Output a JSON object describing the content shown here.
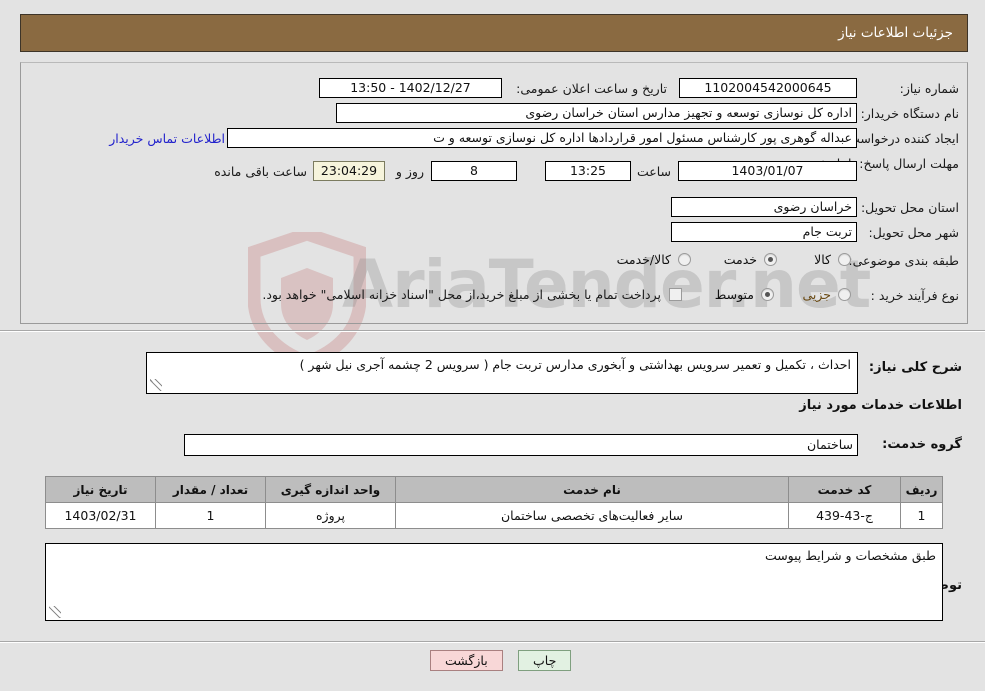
{
  "header": {
    "title": "جزئیات اطلاعات نیاز"
  },
  "watermark": {
    "text": "AriaTender.net",
    "logo_icon": "shield-icon",
    "color": "#888888"
  },
  "info": {
    "need_number": {
      "label": "شماره نیاز:",
      "value": "1102004542000645"
    },
    "announce_datetime": {
      "label": "تاریخ و ساعت اعلان عمومی:",
      "value": "1402/12/27 - 13:50"
    },
    "buyer_org": {
      "label": "نام دستگاه خریدار:",
      "value": "اداره کل نوسازی  توسعه و تجهیز مدارس استان خراسان رضوی"
    },
    "requester": {
      "label": "ایجاد کننده درخواست:",
      "value": "عبداله گوهری پور کارشناس مسئول امور قراردادها  اداره کل نوسازی  توسعه و ت"
    },
    "buyer_contact_link": {
      "label": "اطلاعات تماس خریدار",
      "color": "#2222cc"
    },
    "deadline": {
      "label": "مهلت ارسال پاسخ: تا تاریخ:",
      "date": "1403/01/07",
      "hour_label": "ساعت",
      "hour": "13:25",
      "days": "8",
      "days_suffix": "روز و",
      "countdown": "23:04:29",
      "countdown_suffix": "ساعت باقی مانده"
    },
    "delivery_province": {
      "label": "استان محل تحویل:",
      "value": "خراسان رضوی"
    },
    "delivery_city": {
      "label": "شهر محل تحویل:",
      "value": "تربت جام"
    },
    "category": {
      "label": "طبقه بندی موضوعی:",
      "options": [
        "کالا",
        "خدمت",
        "کالا/خدمت"
      ],
      "selected": "خدمت"
    },
    "purchase_process": {
      "label": "نوع فرآیند خرید :",
      "options": [
        "جزیی",
        "متوسط"
      ],
      "selected": "متوسط"
    },
    "treasury_note": {
      "checked": false,
      "text": "پرداخت تمام یا بخشی از مبلغ خرید،از محل \"اسناد خزانه اسلامی\" خواهد بود."
    }
  },
  "main": {
    "need_summary": {
      "label": "شرح کلی نیاز:",
      "value": "احداث ، تکمیل و تعمیر سرویس بهداشتی و آبخوری مدارس تربت جام ( سرویس 2 چشمه آجری نیل شهر )"
    },
    "services_section_title": "اطلاعات خدمات مورد نیاز",
    "service_group": {
      "label": "گروه خدمت:",
      "value": "ساختمان"
    },
    "table": {
      "columns": [
        "ردیف",
        "کد خدمت",
        "نام خدمت",
        "واحد اندازه گیری",
        "تعداد / مقدار",
        "تاریخ نیاز"
      ],
      "rows": [
        {
          "row": "1",
          "service_code": "ج-43-439",
          "service_name": "سایر فعالیت‌های تخصصی ساختمان",
          "unit": "پروژه",
          "quantity": "1",
          "need_date": "1403/02/31"
        }
      ]
    },
    "buyer_notes": {
      "label": "توضیحات خریدار:",
      "value": "طبق مشخصات و شرایط پیوست"
    }
  },
  "footer": {
    "back_button": "بازگشت",
    "print_button": "چاپ"
  }
}
